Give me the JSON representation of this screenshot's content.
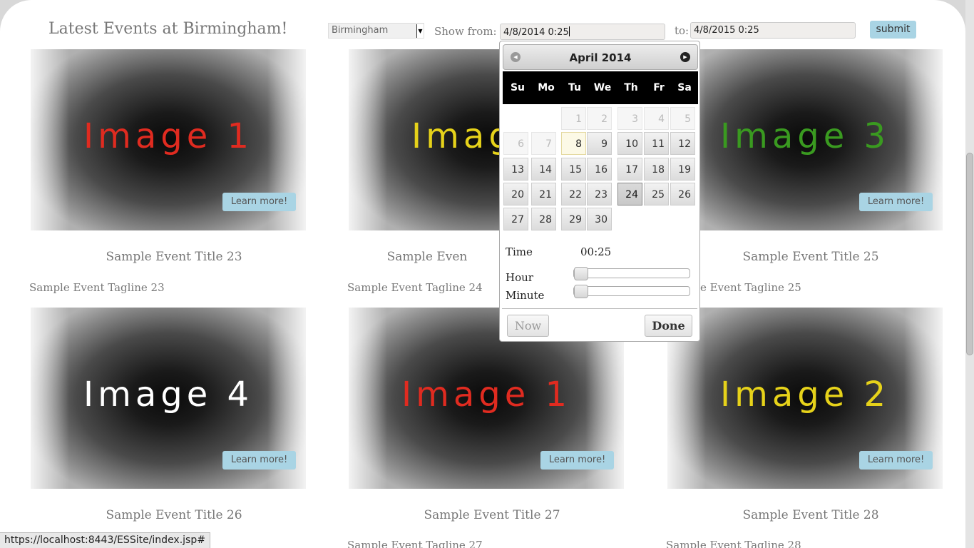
{
  "header": {
    "title": "Latest Events at Birmingham!"
  },
  "filters": {
    "city_value": "Birmingham",
    "show_from_label": "Show from:",
    "from_value": "4/8/2014 0:25",
    "to_label": "to:",
    "to_value": "4/8/2015 0:25",
    "submit_label": "submit"
  },
  "cards": [
    {
      "image_label": "Image 1",
      "image_color": "#e02b20",
      "button": "Learn more!",
      "title": "Sample Event Title 23",
      "tagline": "Sample Event Tagline 23"
    },
    {
      "image_label": "Imag",
      "image_color": "#e6d21a",
      "title": "Sample Even",
      "tagline": "Sample Event Tagline 24"
    },
    {
      "image_label": "Image 3",
      "image_color": "#3a9a20",
      "button": "Learn more!",
      "title": "Sample Event Title 25",
      "tagline": "e Event Tagline 25"
    },
    {
      "image_label": "Image 4",
      "image_color": "#ffffff",
      "button": "Learn more!",
      "title": "Sample Event Title 26"
    },
    {
      "image_label": "Image 1",
      "image_color": "#e02b20",
      "button": "Learn more!",
      "title": "Sample Event Title 27",
      "tagline": "Sample Event Tagline 27"
    },
    {
      "image_label": "Image 2",
      "image_color": "#e6d21a",
      "button": "Learn more!",
      "title": "Sample Event Title 28",
      "tagline": "Sample Event Tagline 28"
    }
  ],
  "datepicker": {
    "month_title": "April 2014",
    "prev_icon": "chevron-left-icon",
    "next_icon": "chevron-right-icon",
    "weekdays": [
      "Su",
      "Mo",
      "Tu",
      "We",
      "Th",
      "Fr",
      "Sa"
    ],
    "days": [
      {
        "label": "1",
        "state": "muted"
      },
      {
        "label": "2",
        "state": "muted"
      },
      {
        "label": "3",
        "state": "muted"
      },
      {
        "label": "4",
        "state": "muted"
      },
      {
        "label": "5",
        "state": "muted"
      },
      {
        "label": "6",
        "state": "muted"
      },
      {
        "label": "7",
        "state": "muted"
      },
      {
        "label": "8",
        "state": "today"
      },
      {
        "label": "9"
      },
      {
        "label": "10"
      },
      {
        "label": "11"
      },
      {
        "label": "12"
      },
      {
        "label": "13"
      },
      {
        "label": "14"
      },
      {
        "label": "15"
      },
      {
        "label": "16"
      },
      {
        "label": "17"
      },
      {
        "label": "18"
      },
      {
        "label": "19"
      },
      {
        "label": "20"
      },
      {
        "label": "21"
      },
      {
        "label": "22"
      },
      {
        "label": "23"
      },
      {
        "label": "24",
        "state": "active"
      },
      {
        "label": "25"
      },
      {
        "label": "26"
      },
      {
        "label": "27"
      },
      {
        "label": "28"
      },
      {
        "label": "29"
      },
      {
        "label": "30"
      }
    ],
    "time_label": "Time",
    "time_value": "00:25",
    "hour_label": "Hour",
    "minute_label": "Minute",
    "hour_value": 0,
    "minute_value": 25,
    "now_label": "Now",
    "done_label": "Done"
  },
  "status_bar": {
    "url": "https://localhost:8443/ESSite/index.jsp#"
  }
}
